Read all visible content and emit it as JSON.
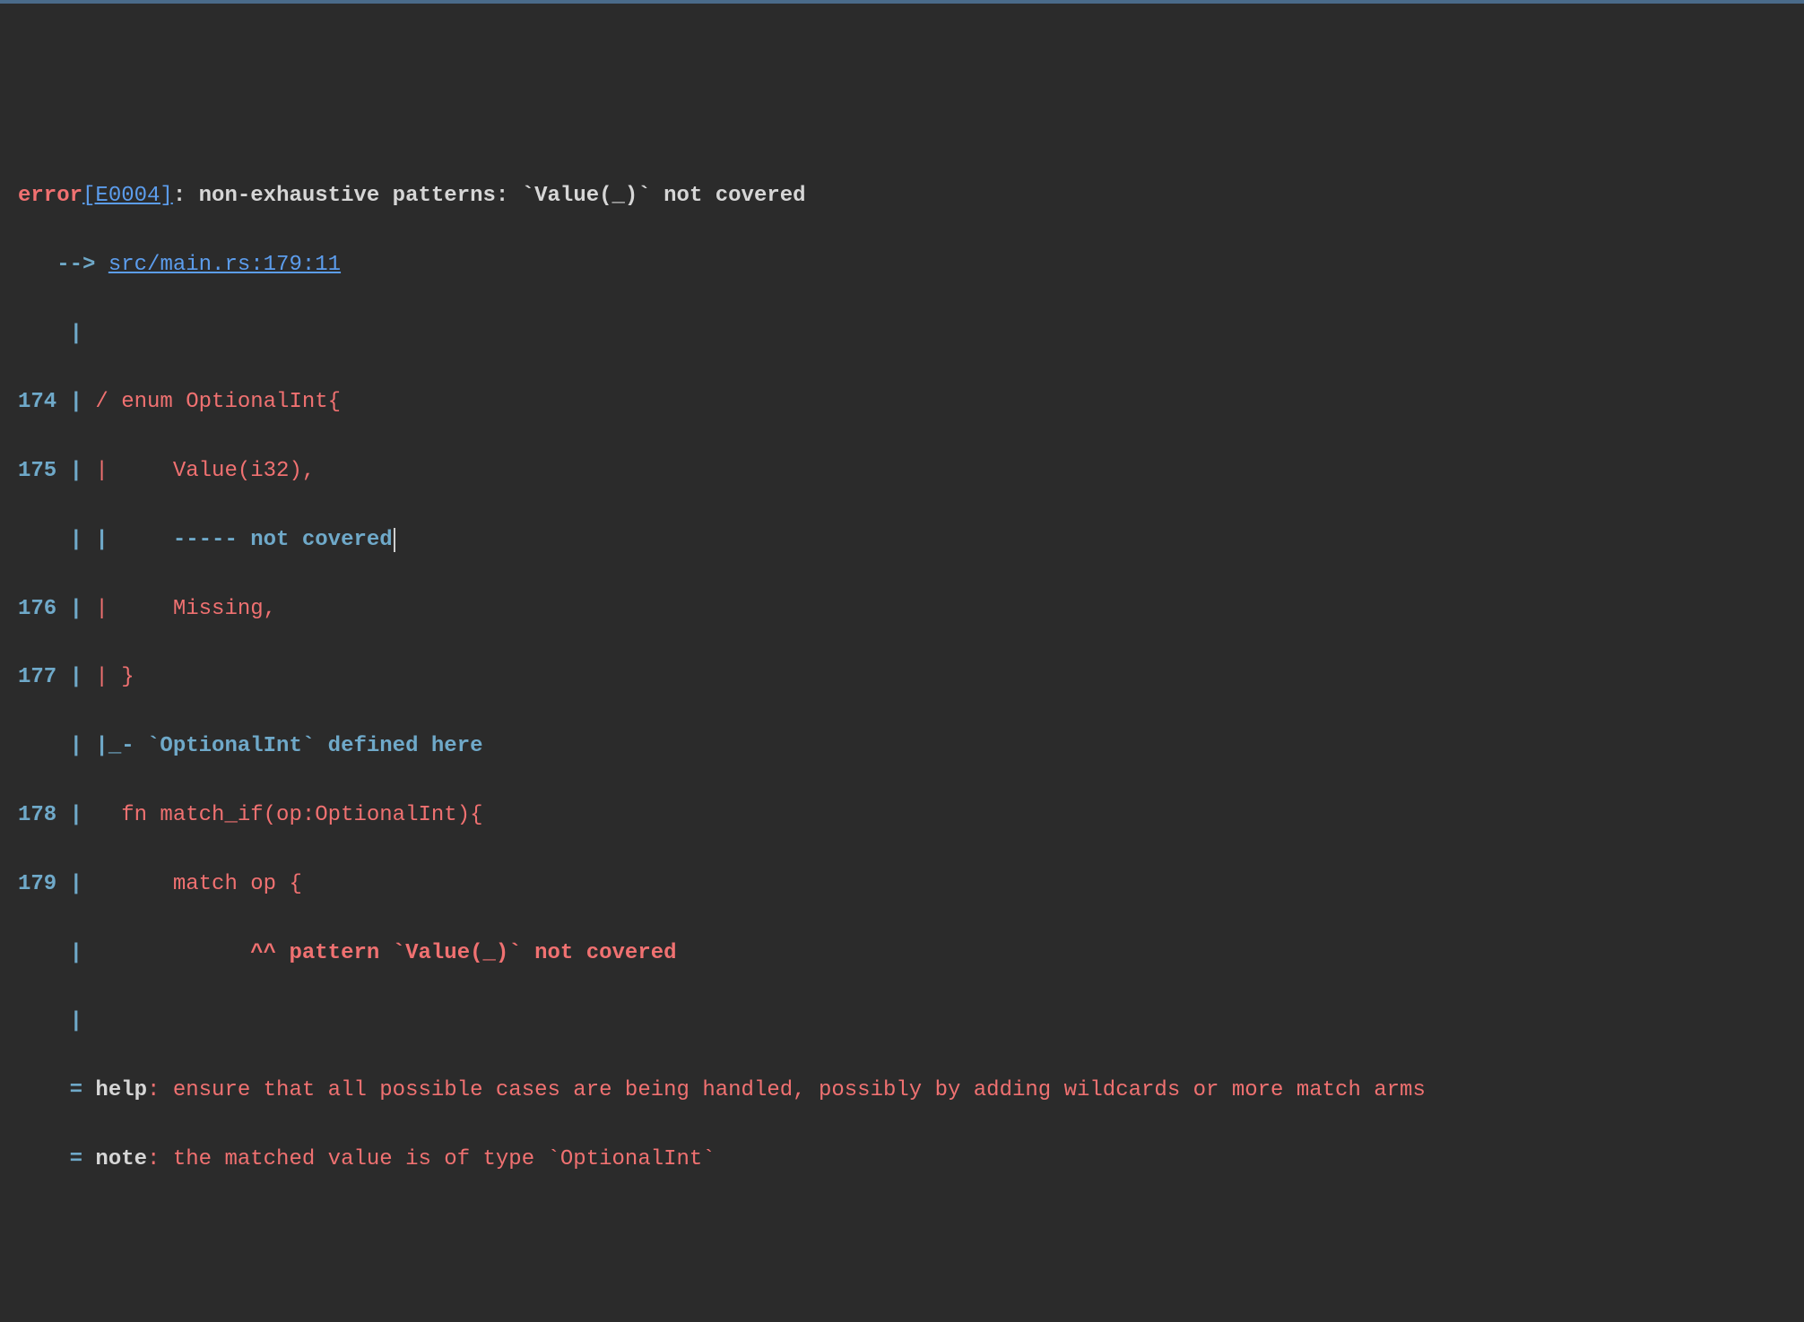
{
  "header": {
    "error_label": "error",
    "error_code": "[E0004]",
    "error_message": ": non-exhaustive patterns: `Value(_)` not covered",
    "arrow": "   --> ",
    "location": "src/main.rs:179:11"
  },
  "gutter": {
    "empty": "    | ",
    "l174": "174 | ",
    "l175": "175 | ",
    "l176": "176 | ",
    "l177": "177 | ",
    "l178": "178 | ",
    "l179": "179 | ",
    "eq": "    = "
  },
  "code": {
    "l174": "/ enum OptionalInt{",
    "l175": "|     Value(i32),",
    "underline_dashes": "|     ----- ",
    "underline_label": "not covered",
    "l176": "|     Missing,",
    "l177": "| }",
    "defined_here_bar": "|_- ",
    "defined_here_text": "`OptionalInt` defined here",
    "l178": "  fn match_if(op:OptionalInt){",
    "l179": "      match op {",
    "caret_pad": "            ",
    "carets": "^^ ",
    "caret_label": "pattern `Value(_)` not covered"
  },
  "footer": {
    "help_label": "help",
    "help_text": ": ensure that all possible cases are being handled, possibly by adding wildcards or more match arms",
    "note_label": "note",
    "note_text": ": the matched value is of type `OptionalInt`"
  }
}
